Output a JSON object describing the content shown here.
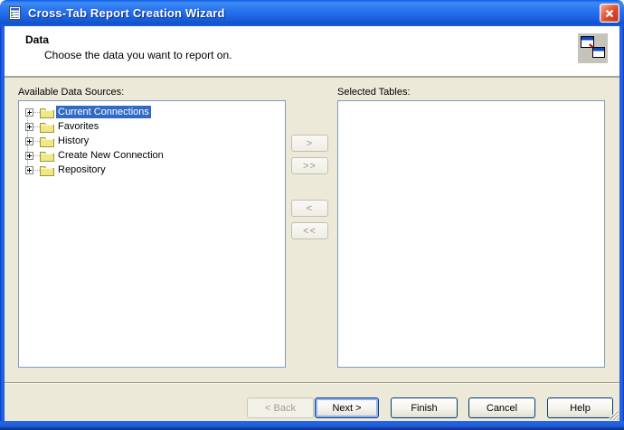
{
  "window": {
    "title": "Cross-Tab Report Creation Wizard"
  },
  "header": {
    "title": "Data",
    "subtitle": "Choose the data you want to report on."
  },
  "panels": {
    "available_label": "Available Data Sources:",
    "selected_label": "Selected Tables:"
  },
  "tree": {
    "items": [
      {
        "label": "Current Connections",
        "selected": true
      },
      {
        "label": "Favorites",
        "selected": false
      },
      {
        "label": "History",
        "selected": false
      },
      {
        "label": "Create New Connection",
        "selected": false
      },
      {
        "label": "Repository",
        "selected": false
      }
    ]
  },
  "transfer": {
    "add_one": ">",
    "add_all": ">>",
    "remove_one": "<",
    "remove_all": "<<"
  },
  "footer": {
    "back_label": "< Back",
    "next_label": "Next >",
    "finish_label": "Finish",
    "cancel_label": "Cancel",
    "help_label": "Help"
  },
  "colors": {
    "titlebar_blue": "#1E66E8",
    "dialog_background": "#ECE9D8",
    "selection_blue": "#316AC5",
    "box_border": "#7F9DB9",
    "close_button_red": "#D9462A"
  }
}
